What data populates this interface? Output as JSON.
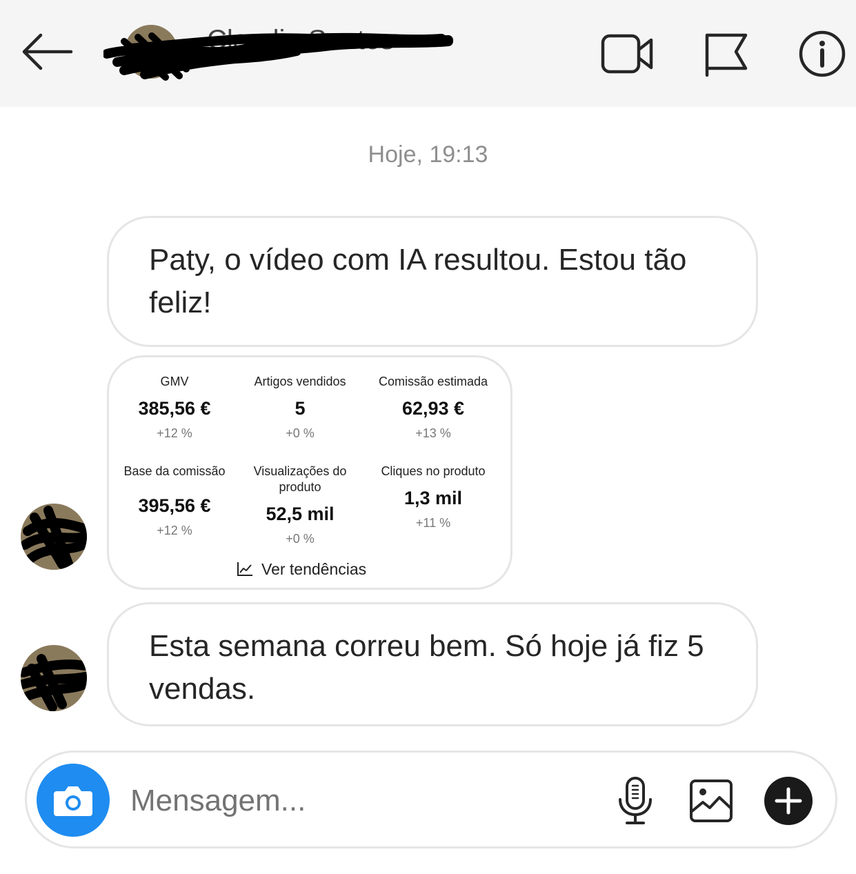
{
  "header": {
    "contact_name": "Claudia Santos",
    "icons": [
      "back-arrow-icon",
      "video-call-icon",
      "flag-icon",
      "info-icon"
    ]
  },
  "conversation": {
    "timestamp": "Hoje, 19:13",
    "messages": [
      {
        "type": "text",
        "text": "Paty, o vídeo com IA resultou. Estou tão feliz!"
      },
      {
        "type": "stats_card",
        "stats": [
          {
            "label": "GMV",
            "value": "385,56 €",
            "delta": "+12 %"
          },
          {
            "label": "Artigos vendidos",
            "value": "5",
            "delta": "+0 %"
          },
          {
            "label": "Comissão estimada",
            "value": "62,93 €",
            "delta": "+13 %"
          },
          {
            "label": "Base da comissão",
            "value": "395,56 €",
            "delta": "+12 %"
          },
          {
            "label": "Visualizações do produto",
            "value": "52,5 mil",
            "delta": "+0 %"
          },
          {
            "label": "Cliques no produto",
            "value": "1,3 mil",
            "delta": "+11 %"
          }
        ],
        "link_label": "Ver tendências"
      },
      {
        "type": "text",
        "text": "Esta semana correu bem. Só hoje já fiz 5 vendas."
      }
    ]
  },
  "composer": {
    "placeholder": "Mensagem...",
    "accent_color": "#1e8cf0"
  }
}
